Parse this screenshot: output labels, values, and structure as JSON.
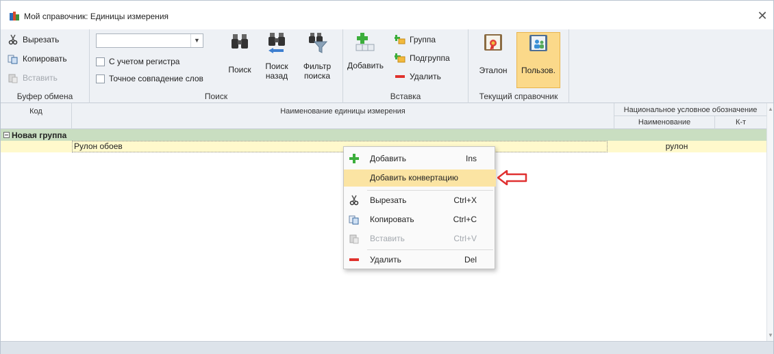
{
  "window": {
    "title": "Мой справочник: Единицы  измерения"
  },
  "ribbon": {
    "clipboard": {
      "label": "Буфер обмена",
      "cut": "Вырезать",
      "copy": "Копировать",
      "paste": "Вставить"
    },
    "search": {
      "label": "Поиск",
      "combo_value": "",
      "match_case": "С учетом регистра",
      "exact_match": "Точное совпадение слов",
      "find": "Поиск",
      "find_back_1": "Поиск",
      "find_back_2": "назад",
      "filter_1": "Фильтр",
      "filter_2": "поиска"
    },
    "insert": {
      "label": "Вставка",
      "add": "Добавить",
      "group": "Группа",
      "subgroup": "Подгруппа",
      "delete": "Удалить"
    },
    "current_dict": {
      "label": "Текущий справочник",
      "etalon": "Эталон",
      "user": "Пользов."
    }
  },
  "grid": {
    "headers": {
      "code": "Код",
      "name": "Наименование единицы измерения",
      "national": "Национальное условное обозначение",
      "national_name": "Наименование",
      "coef": "К-т"
    },
    "group_row": "Новая группа",
    "rows": [
      {
        "code": "",
        "name": "Рулон обоев",
        "national_name": "рулон",
        "coef": ""
      }
    ]
  },
  "context_menu": {
    "items": [
      {
        "label": "Добавить",
        "shortcut": "Ins"
      },
      {
        "label": "Добавить конвертацию",
        "shortcut": ""
      },
      {
        "label": "Вырезать",
        "shortcut": "Ctrl+X"
      },
      {
        "label": "Копировать",
        "shortcut": "Ctrl+C"
      },
      {
        "label": "Вставить",
        "shortcut": "Ctrl+V"
      },
      {
        "label": "Удалить",
        "shortcut": "Del"
      }
    ]
  },
  "colors": {
    "highlight": "#fbe4a3",
    "group_row": "#c9dec1",
    "selected_row": "#fff9cc",
    "active_button": "#fbd98a",
    "arrow": "#e03030"
  }
}
